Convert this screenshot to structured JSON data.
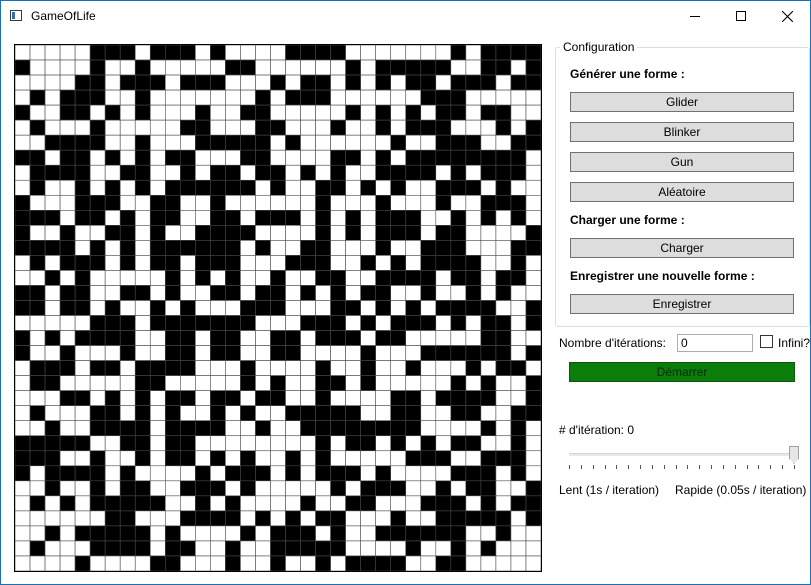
{
  "window": {
    "title": "GameOfLife",
    "controls": [
      "minimize",
      "maximize",
      "close"
    ]
  },
  "grid": {
    "rows": 35,
    "cols": 35,
    "alive_color": "#000000",
    "dead_color": "#ffffff",
    "line_color": "#4a4a4a",
    "seed": 20240611,
    "density": 0.48
  },
  "config": {
    "legend": "Configuration",
    "generate_label": "Générer une forme :",
    "buttons": {
      "glider": "Glider",
      "blinker": "Blinker",
      "gun": "Gun",
      "random": "Aléatoire"
    },
    "load_label": "Charger une forme :",
    "load_button": "Charger",
    "save_label": "Enregistrer une nouvelle forme :",
    "save_button": "Enregistrer"
  },
  "iterations": {
    "label": "Nombre d'itérations:",
    "value": "0",
    "infinite_label": "Infini?",
    "infinite_checked": false
  },
  "start_button": "Démarrer",
  "start_color": "#0b7d0b",
  "iteration_counter": "# d'itération: 0",
  "speed": {
    "slow_label": "Lent (1s / iteration)",
    "fast_label": "Rapide (0.05s / iteration)",
    "slider_value_fraction": 1.0,
    "tick_count": 20
  }
}
